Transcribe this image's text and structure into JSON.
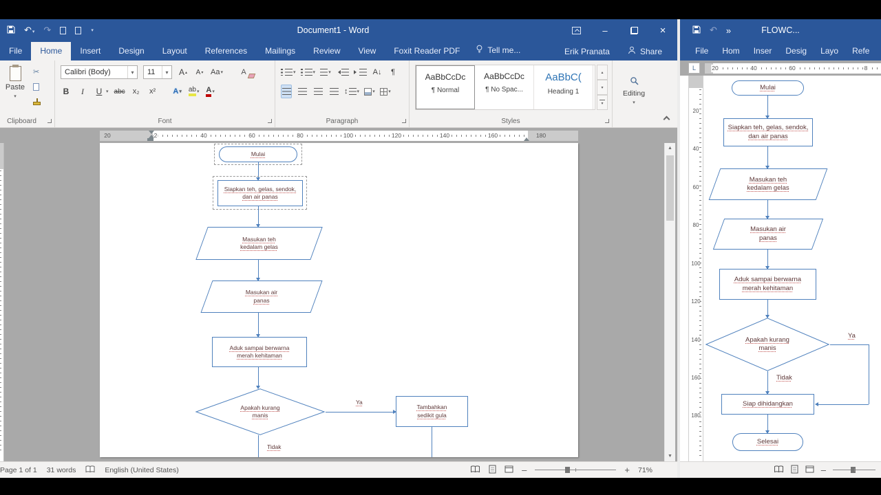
{
  "icons": {
    "dropdown": "▾",
    "up_arrow": "▴",
    "undo": "↶",
    "redo": "↷",
    "overflow": "»",
    "minimize": "–",
    "close": "×",
    "cut": "✂",
    "paragraph_mark": "¶",
    "sort": "A↓",
    "line_spacing": "↕",
    "scroll_up": "▲",
    "scroll_down": "▼",
    "tab_selector": "L",
    "zoom_out": "–",
    "zoom_in": "+"
  },
  "chrome": {
    "title": "Document1 - Word",
    "tabs": [
      "File",
      "Home",
      "Insert",
      "Design",
      "Layout",
      "References",
      "Mailings",
      "Review",
      "View",
      "Foxit Reader PDF"
    ],
    "tell_me": "Tell me...",
    "account_name": "Erik Pranata",
    "share_label": "Share"
  },
  "right_chrome": {
    "title": "FLOWC...",
    "tabs": [
      "File",
      "Hom",
      "Inser",
      "Desig",
      "Layo",
      "Refe"
    ]
  },
  "ribbon": {
    "clipboard": {
      "label": "Clipboard",
      "paste": "Paste"
    },
    "font": {
      "label": "Font",
      "family": "Calibri (Body)",
      "size": "11",
      "bold": "B",
      "italic": "I",
      "underline": "U",
      "strikethrough": "abc",
      "subscript": "x₂",
      "superscript": "x²",
      "grow": "A",
      "shrink": "A",
      "change_case": "Aa",
      "clear": "A",
      "effects": "A",
      "highlight": "ab",
      "font_color": "A"
    },
    "paragraph": {
      "label": "Paragraph"
    },
    "styles": {
      "label": "Styles",
      "items": [
        {
          "preview": "AaBbCcDc",
          "name": "¶ Normal"
        },
        {
          "preview": "AaBbCcDc",
          "name": "¶ No Spac..."
        },
        {
          "preview": "AaBbC(",
          "name": "Heading 1"
        }
      ]
    },
    "editing": {
      "label": "Editing"
    }
  },
  "ruler": {
    "left_h": [
      "20",
      "2",
      "40",
      "60",
      "80",
      "100",
      "120",
      "140",
      "160",
      "180"
    ],
    "right_h": [
      "20",
      "40",
      "60",
      "8"
    ],
    "right_v": [
      "20",
      "40",
      "60",
      "80",
      "100",
      "120",
      "140",
      "160",
      "180"
    ]
  },
  "flowchart": {
    "mulai": "Mulai",
    "siapkan": "Siapkan teh, gelas, sendok, dan air panas",
    "masukan_teh": "Masukan teh kedalam gelas",
    "masukan_air": "Masukan air panas",
    "aduk": "Aduk sampai berwarna merah kehitaman",
    "apakah": "Apakah kurang manis",
    "ya": "Ya",
    "tidak": "Tidak",
    "tambahkan": "Tambahkan sedikit gula",
    "siap": "Siap dihidangkan",
    "selesai": "Selesai"
  },
  "status": {
    "page": "Page 1 of 1",
    "words": "31 words",
    "language": "English (United States)",
    "zoom": "71%"
  }
}
